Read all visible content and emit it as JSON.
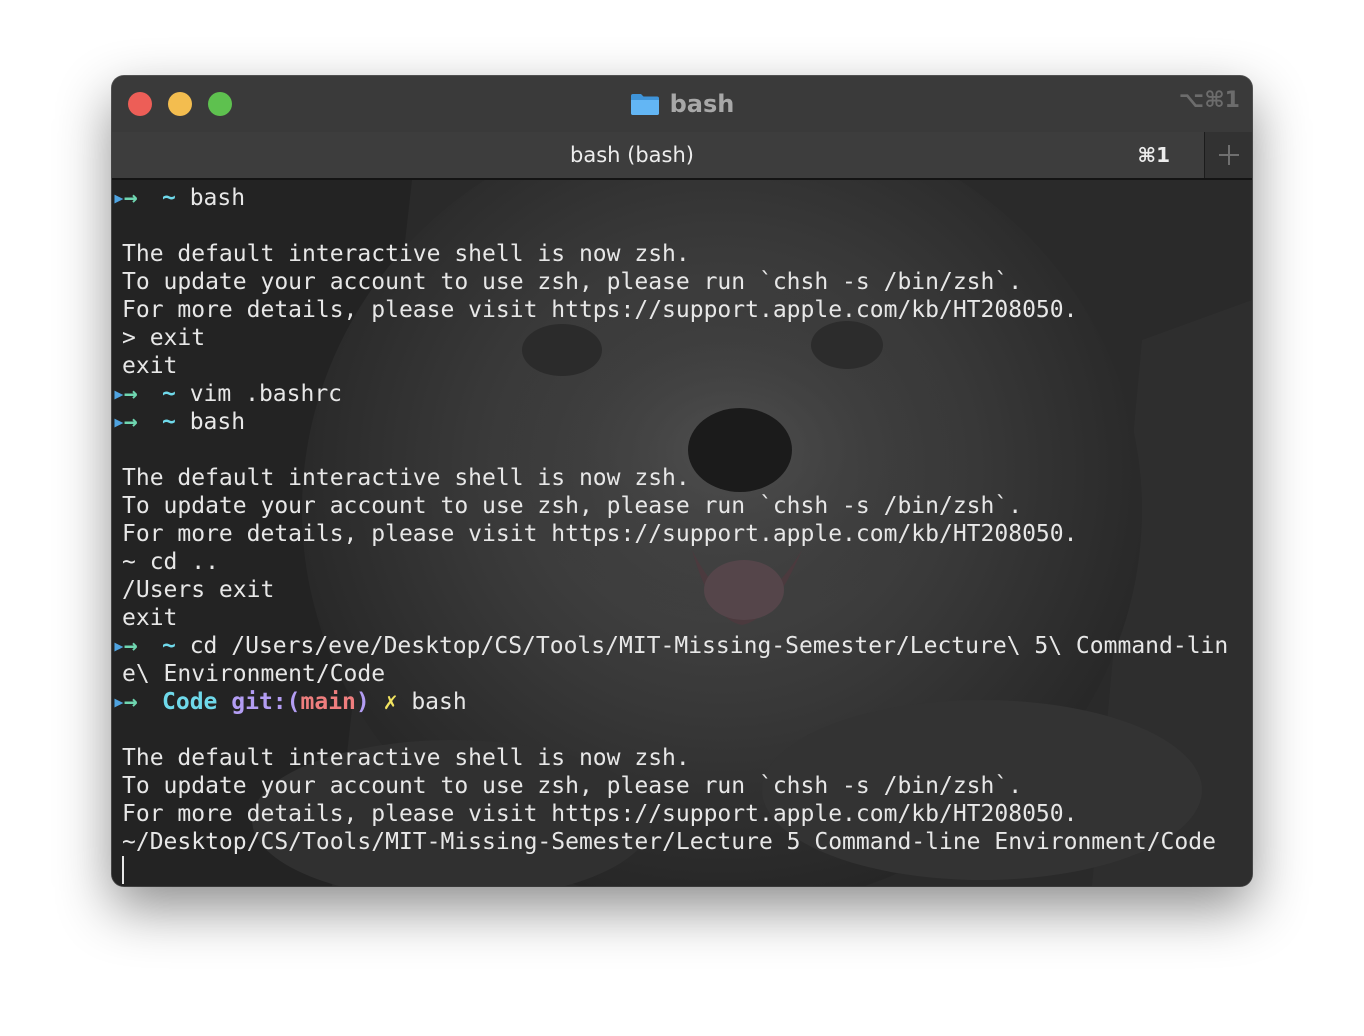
{
  "window": {
    "title": "bash",
    "title_shortcut": "⌥⌘1",
    "title_icon": "folder-icon",
    "traffic_lights": {
      "close": "#ed5e57",
      "minimize": "#f3bd4f",
      "maximize": "#5ec14f"
    }
  },
  "tab": {
    "label": "bash (bash)",
    "shortcut": "⌘1",
    "new_tab_icon": "plus-icon"
  },
  "colors": {
    "prompt_arrow": "#6fd6b0",
    "tilde": "#6fd9ea",
    "git": "#b39df3",
    "branch": "#ef7e7e",
    "dirty": "#f2e460",
    "text": "#e7e7e7"
  },
  "terminal": {
    "lines": [
      {
        "type": "prompt",
        "arrow": "→",
        "dir": "~",
        "cmd": " bash"
      },
      {
        "type": "text",
        "text": ""
      },
      {
        "type": "text",
        "text": "The default interactive shell is now zsh."
      },
      {
        "type": "text",
        "text": "To update your account to use zsh, please run `chsh -s /bin/zsh`."
      },
      {
        "type": "text",
        "text": "For more details, please visit https://support.apple.com/kb/HT208050."
      },
      {
        "type": "text",
        "text": "> exit"
      },
      {
        "type": "text",
        "text": "exit"
      },
      {
        "type": "prompt",
        "arrow": "→",
        "dir": "~",
        "cmd": " vim .bashrc"
      },
      {
        "type": "prompt",
        "arrow": "→",
        "dir": "~",
        "cmd": " bash"
      },
      {
        "type": "text",
        "text": ""
      },
      {
        "type": "text",
        "text": "The default interactive shell is now zsh."
      },
      {
        "type": "text",
        "text": "To update your account to use zsh, please run `chsh -s /bin/zsh`."
      },
      {
        "type": "text",
        "text": "For more details, please visit https://support.apple.com/kb/HT208050."
      },
      {
        "type": "text",
        "text": "~ cd .."
      },
      {
        "type": "text",
        "text": "/Users exit"
      },
      {
        "type": "text",
        "text": "exit"
      },
      {
        "type": "prompt",
        "arrow": "→",
        "dir": "~",
        "cmd": " cd /Users/eve/Desktop/CS/Tools/MIT-Missing-Semester/Lecture\\ 5\\ Command-lin"
      },
      {
        "type": "text",
        "text": "e\\ Environment/Code"
      },
      {
        "type": "git_prompt",
        "arrow": "→",
        "dir": "Code",
        "git_label": "git:(",
        "branch": "main",
        "git_close": ")",
        "dirty": "✗",
        "cmd": " bash"
      },
      {
        "type": "text",
        "text": ""
      },
      {
        "type": "text",
        "text": "The default interactive shell is now zsh."
      },
      {
        "type": "text",
        "text": "To update your account to use zsh, please run `chsh -s /bin/zsh`."
      },
      {
        "type": "text",
        "text": "For more details, please visit https://support.apple.com/kb/HT208050."
      },
      {
        "type": "text",
        "text": "~/Desktop/CS/Tools/MIT-Missing-Semester/Lecture 5 Command-line Environment/Code"
      }
    ]
  }
}
